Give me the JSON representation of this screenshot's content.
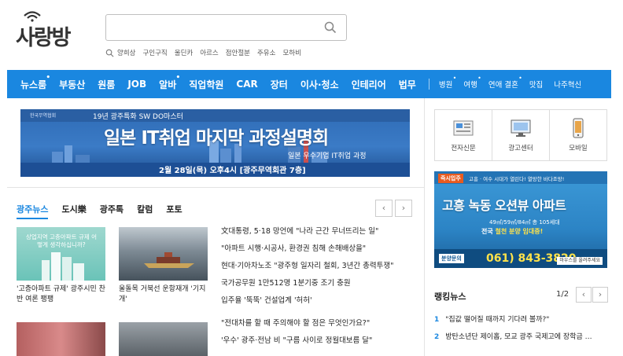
{
  "header": {
    "logo_text": "사랑방",
    "search": {
      "value": "",
      "placeholder": ""
    },
    "keywords": [
      "양희상",
      "구인구직",
      "울딘카",
      "아르스",
      "점안절분",
      "주유소",
      "모하비"
    ]
  },
  "nav": {
    "main": [
      {
        "label": "뉴스룸",
        "dot": "•"
      },
      {
        "label": "부동산",
        "dot": ""
      },
      {
        "label": "원룸",
        "dot": ""
      },
      {
        "label": "JOB",
        "dot": ""
      },
      {
        "label": "알바",
        "dot": "•"
      },
      {
        "label": "직업학원",
        "dot": ""
      },
      {
        "label": "CAR",
        "dot": ""
      },
      {
        "label": "장터",
        "dot": ""
      },
      {
        "label": "이사·청소",
        "dot": ""
      },
      {
        "label": "인테리어",
        "dot": ""
      },
      {
        "label": "법무",
        "dot": ""
      }
    ],
    "sub": [
      {
        "label": "병원",
        "dot": "•"
      },
      {
        "label": "여행",
        "dot": "•"
      },
      {
        "label": "연애 결혼",
        "dot": "•"
      },
      {
        "label": "맛집",
        "dot": ""
      },
      {
        "label": "나주혁신",
        "dot": ""
      }
    ]
  },
  "banner": {
    "small": "19년 광주특화 SW DO마스터",
    "logo": "한국무역협회",
    "title": "일본 IT취업 마지막 과정설명회",
    "subtitle": "일본 우수기업 IT취업 과정",
    "date": "2월 28일(목) 오후4시 [광주무역회관 7층]"
  },
  "news": {
    "tabs": [
      "광주뉴스",
      "도시樂",
      "광주톡",
      "칼럼",
      "포토"
    ],
    "prev": "‹",
    "next": "›",
    "thumb1_text": "상업지역 고층아파트 규제 어떻게 생각하십니까?",
    "captions": [
      "'고층아파트 규제' 광주시민 찬반 여론 팽팽",
      "울돌목 거북선 운항재개 '기지개'"
    ],
    "headlines": [
      "文대통령, 5·18 망언에 \"나라 근간 무너뜨리는 일\"",
      "\"아파트 시행·시공사, 환경권 침해 손해배상을\"",
      "현대·기아차노조 \"광주형 일자리 철회, 3년간 총력투쟁\"",
      "국가공무원 1만512명 1분기중 조기 충원",
      "입주율 '뚝뚝' 건설업계 '허허'"
    ],
    "headlines2": [
      "\"전대차를 할 때 주의해야 할 점은 무엇인가요?\"",
      "'우수' 광주·전남 비 \"구름 사이로 정월대보름 달\""
    ]
  },
  "quick_links": [
    {
      "label": "전자신문",
      "icon": "newspaper-icon"
    },
    {
      "label": "광고센터",
      "icon": "monitor-icon"
    },
    {
      "label": "모바일",
      "icon": "mobile-icon"
    }
  ],
  "ad": {
    "badge": "즉시입주",
    "top": "고흥 · 여수 시대가 열린다! 열망한 바다조망!",
    "title": "고흥 녹동 오션뷰 아파트",
    "line1": "49㎡/59㎡/84㎡ 총 105세대",
    "line2_prefix": "전국 ",
    "line2_highlight": "철천 분양 임대중!",
    "call": "분양문의",
    "phone": "061) 843-3820",
    "more": "마우스를 올려주세요"
  },
  "ranking": {
    "title": "랭킹뉴스",
    "page": "1/2",
    "items": [
      {
        "num": "1",
        "text": "\"집값 떨어질 때까지 기다려 볼까?\""
      },
      {
        "num": "2",
        "text": "방탄소년단 제이홉, 모교 광주 국제고에 장학금 …"
      }
    ]
  },
  "colors": {
    "accent": "#1a87e0",
    "nav_bg": "#1a87e0"
  }
}
